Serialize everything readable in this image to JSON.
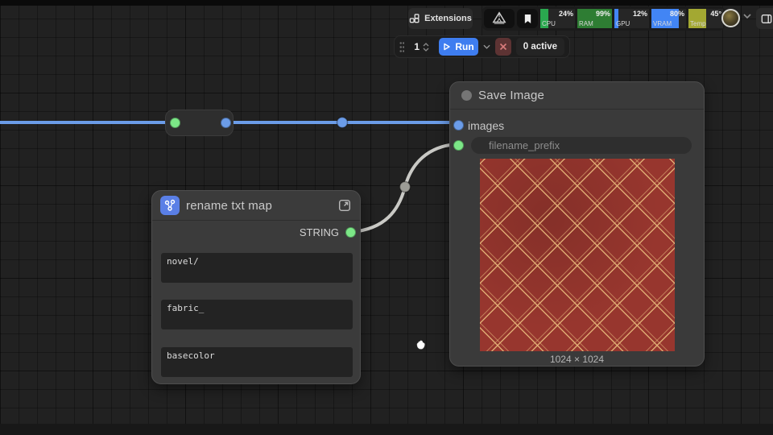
{
  "topbar": {
    "extensions_label": "Extensions",
    "monitors": [
      {
        "name": "CPU",
        "value": "24%",
        "fill": 24,
        "color": "#2aa84f"
      },
      {
        "name": "RAM",
        "value": "99%",
        "fill": 99,
        "color": "#2e7d33"
      },
      {
        "name": "GPU",
        "value": "12%",
        "fill": 12,
        "color": "#4285f4"
      },
      {
        "name": "VRAM",
        "value": "80%",
        "fill": 80,
        "color": "#4285f4"
      },
      {
        "name": "Temp",
        "value": "45°",
        "fill": 52,
        "color": "#a3a832"
      }
    ]
  },
  "runbar": {
    "queue_count": "1",
    "run_label": "Run",
    "active_label": "0 active"
  },
  "nodes": {
    "save_image": {
      "title": "Save Image",
      "inputs": [
        {
          "label": "images"
        },
        {
          "label": "filename_prefix"
        }
      ],
      "image_caption": "1024 × 1024"
    },
    "rename_txt_map": {
      "title": "rename txt map",
      "output_label": "STRING",
      "fields": [
        "novel/",
        "fabric_",
        "basecolor"
      ]
    }
  },
  "colors": {
    "wire_blue": "#6b9ce8",
    "wire_gray": "#c9c9c5",
    "socket_green": "#7ce787",
    "run_button": "#3e7df0"
  }
}
